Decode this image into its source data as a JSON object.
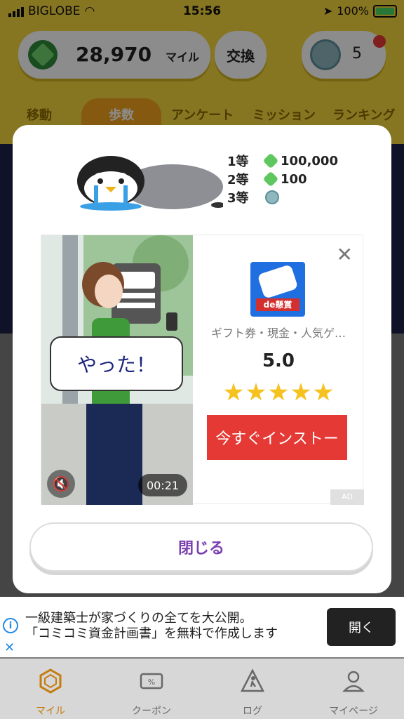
{
  "status_bar": {
    "carrier": "BIGLOBE",
    "time": "15:56",
    "battery": "100%"
  },
  "header": {
    "miles_value": "28,970",
    "miles_unit": "マイル",
    "exchange_label": "交換",
    "ticket_count": "5"
  },
  "tabs": [
    {
      "label": "移動"
    },
    {
      "label": "歩数"
    },
    {
      "label": "アンケート"
    },
    {
      "label": "ミッション"
    },
    {
      "label": "ランキング"
    }
  ],
  "modal": {
    "prizes": [
      {
        "rank": "1等",
        "value": "100,000"
      },
      {
        "rank": "2等",
        "value": "100"
      },
      {
        "rank": "3等",
        "value": ""
      }
    ],
    "ad": {
      "app_badge": "de懸賞",
      "description": "ギフト券・現金・人気ゲ…",
      "rating": "5.0",
      "install_label": "今すぐインストー",
      "speech": "やった！",
      "timer": "00:21",
      "ad_label": "AD"
    },
    "close_label": "閉じる"
  },
  "banner": {
    "line1": "一級建築士が家づくりの全てを大公開。",
    "line2": "「コミコミ資金計画書」を無料で作成します",
    "open_label": "開く"
  },
  "bottom_nav": [
    {
      "label": "マイル"
    },
    {
      "label": "クーポン"
    },
    {
      "label": "ログ"
    },
    {
      "label": "マイページ"
    }
  ],
  "colors": {
    "header_yellow": "#f5d63d",
    "tab_active": "#f2a21e",
    "install_red": "#e53935",
    "close_text": "#7a3fb0"
  }
}
